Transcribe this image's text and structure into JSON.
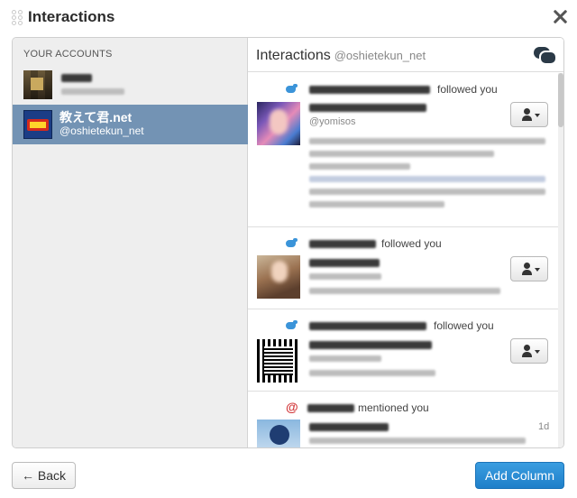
{
  "dialog": {
    "title": "Interactions",
    "close_icon": "close-icon"
  },
  "accounts": {
    "header": "YOUR ACCOUNTS",
    "items": [
      {
        "name": "",
        "handle": "",
        "selected": false
      },
      {
        "name": "教えて君.net",
        "handle": "@oshietekun_net",
        "selected": true
      }
    ]
  },
  "column": {
    "title": "Interactions",
    "handle": "@oshietekun_net",
    "header_icon": "conversation-icon",
    "items": [
      {
        "type": "follow",
        "icon": "twitter-bird-icon",
        "action": "followed you",
        "handle": "@yomisos",
        "time": ""
      },
      {
        "type": "follow",
        "icon": "twitter-bird-icon",
        "action": "followed you",
        "handle": "",
        "time": ""
      },
      {
        "type": "follow",
        "icon": "twitter-bird-icon",
        "action": "followed you",
        "handle": "",
        "time": ""
      },
      {
        "type": "mention",
        "icon": "at-icon",
        "action": "mentioned you",
        "handle": "",
        "time": "1d"
      }
    ]
  },
  "footer": {
    "back_label": "← Back",
    "add_column_label": "Add Column"
  },
  "colors": {
    "selected_account": "#7393b4",
    "twitter_blue": "#3b94d9",
    "primary_button": "#2a8cd4",
    "mention": "#d2383a"
  }
}
